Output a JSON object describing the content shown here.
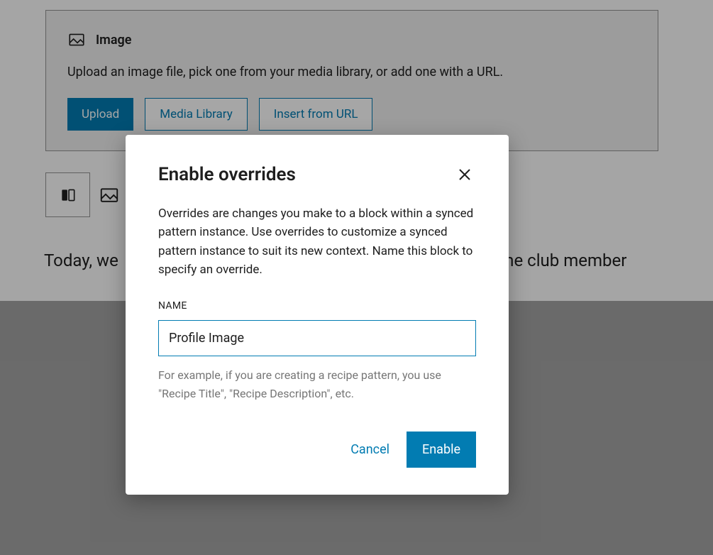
{
  "imageBlock": {
    "title": "Image",
    "description": "Upload an image file, pick one from your media library, or add one with a URL.",
    "buttons": {
      "upload": "Upload",
      "mediaLibrary": "Media Library",
      "insertUrl": "Insert from URL"
    }
  },
  "paragraph": "Today, we                                                                  been a long-time club member",
  "modal": {
    "title": "Enable overrides",
    "description": "Overrides are changes you make to a block within a synced pattern instance. Use overrides to customize a synced pattern instance to suit its new context. Name this block to specify an override.",
    "nameLabel": "NAME",
    "nameValue": "Profile Image",
    "helpText": "For example, if you are creating a recipe pattern, you use \"Recipe Title\", \"Recipe Description\", etc.",
    "cancelLabel": "Cancel",
    "enableLabel": "Enable"
  }
}
